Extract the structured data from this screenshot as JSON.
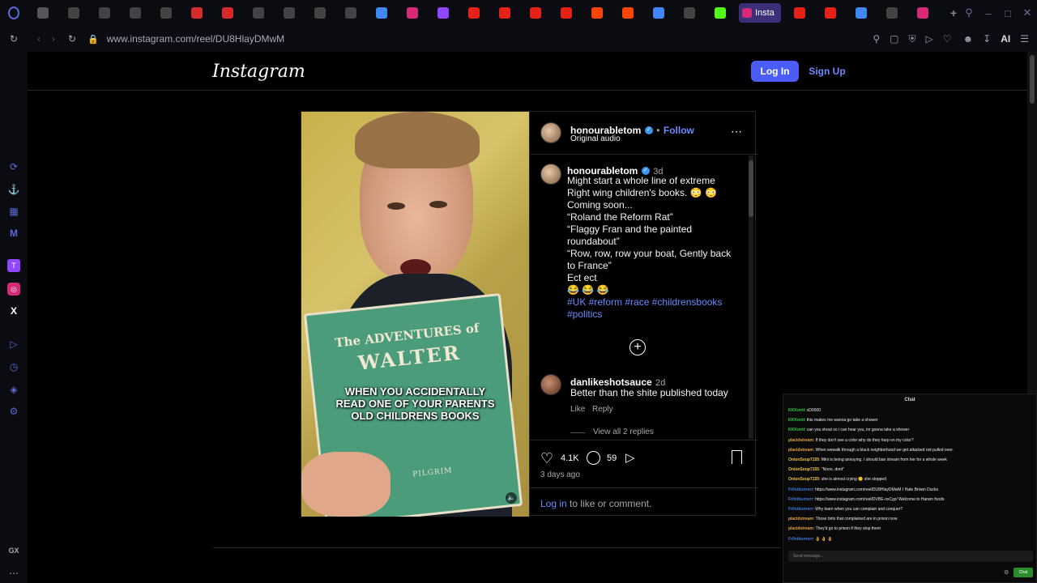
{
  "browser": {
    "url": "www.instagram.com/reel/DU8HlayDMwM",
    "active_tab_label": "Insta",
    "ai_label": "AI",
    "tabs": [
      {
        "icon": "mail-icon",
        "color": "#555"
      },
      {
        "icon": "x-icon",
        "color": "#444"
      },
      {
        "icon": "x-icon",
        "color": "#444"
      },
      {
        "icon": "x-icon",
        "color": "#444"
      },
      {
        "icon": "x-icon",
        "color": "#444"
      },
      {
        "icon": "red-play-icon",
        "color": "#d62b2b"
      },
      {
        "icon": "red-play-icon",
        "color": "#d62b2b"
      },
      {
        "icon": "x-icon",
        "color": "#444"
      },
      {
        "icon": "x-icon",
        "color": "#444"
      },
      {
        "icon": "x-icon",
        "color": "#444"
      },
      {
        "icon": "x-icon",
        "color": "#444"
      },
      {
        "icon": "google-icon",
        "color": "#4285f4"
      },
      {
        "icon": "instagram-icon",
        "color": "#d62976"
      },
      {
        "icon": "twitch-icon",
        "color": "#9146ff"
      },
      {
        "icon": "youtube-icon",
        "color": "#e62117"
      },
      {
        "icon": "youtube-icon",
        "color": "#e62117"
      },
      {
        "icon": "alert-icon",
        "color": "#e62117"
      },
      {
        "icon": "youtube-icon",
        "color": "#e62117"
      },
      {
        "icon": "reddit-icon",
        "color": "#ff4500"
      },
      {
        "icon": "reddit-icon",
        "color": "#ff4500"
      },
      {
        "icon": "google-icon",
        "color": "#4285f4"
      },
      {
        "icon": "x-icon",
        "color": "#444"
      },
      {
        "icon": "kick-icon",
        "color": "#53fc18"
      }
    ],
    "tabs_after": [
      {
        "icon": "youtube-icon",
        "color": "#e62117"
      },
      {
        "icon": "youtube-icon",
        "color": "#e62117"
      },
      {
        "icon": "google-icon",
        "color": "#4285f4"
      },
      {
        "icon": "x-icon",
        "color": "#444"
      },
      {
        "icon": "instagram-icon",
        "color": "#d62976"
      }
    ]
  },
  "instagram": {
    "logo": "Instagram",
    "login_label": "Log In",
    "signup_label": "Sign Up",
    "username": "honourabletom",
    "follow_label": "Follow",
    "audio_label": "Original audio",
    "caption_time": "3d",
    "caption_lines": [
      "Might start a whole line of extreme",
      "Right wing children's books. 😳 😳",
      "Coming soon...",
      "“Roland the Reform Rat”",
      "“Flaggy Fran and the painted",
      "roundabout”",
      "“Row, row, row your boat, Gently back",
      "to France”",
      "Ect ect",
      "😂 😂 😂"
    ],
    "hashtags_line1": "#UK #reform #race #childrensbooks",
    "hashtags_line2": "#politics",
    "comment": {
      "username": "danlikeshotsauce",
      "time": "2d",
      "text": "Better than the shite published today",
      "like_label": "Like",
      "reply_label": "Reply",
      "view_replies": "View all 2 replies"
    },
    "likes": "4.1K",
    "comments_count": "59",
    "posted": "3 days ago",
    "login_prompt_link": "Log in",
    "login_prompt_rest": " to like or comment.",
    "video_caption": [
      "WHEN YOU ACCIDENTALLY",
      "READ ONE OF YOUR PARENTS",
      "OLD CHILDRENS BOOKS"
    ],
    "book_title_1": "The ADVENTURES of",
    "book_title_2": "WALTER",
    "book_bottom": "PILGRIM"
  },
  "chat": {
    "title": "Chat",
    "placeholder": "Send message...",
    "send_label": "Chat",
    "messages": [
      {
        "user": "KKKonti",
        "text": "xD0000",
        "color": "#27c93f"
      },
      {
        "user": "KKKonti",
        "text": "this makes me wanna go take a shower",
        "color": "#27c93f"
      },
      {
        "user": "KKKonti",
        "text": "can you shout so i can hear you, im gonna take a shower",
        "color": "#27c93f"
      },
      {
        "user": "placidstream",
        "text": "If they don't see a color why do they harp on my color?",
        "color": "#e8a23a"
      },
      {
        "user": "placidstream",
        "text": "When wewalk through a black neighborhood we get attacked not pulled over.",
        "color": "#e8a23a"
      },
      {
        "user": "OnionSoup7155",
        "text": "Mini is being annoying. I should ban stream from her for a whole week",
        "color": "#f0c040"
      },
      {
        "user": "OnionSoup7155",
        "text": "\"Nooo, dont\"",
        "color": "#f0c040"
      },
      {
        "user": "OnionSoup7155",
        "text": "she is almost crying 🙂 she stopped",
        "color": "#f0c040"
      },
      {
        "user": "Fr0ntburnerr",
        "text": "https://www.instagram.com/reel/DU8HlayDMwM I Hate Brown Ducks",
        "color": "#3d7bd9"
      },
      {
        "user": "Fr0ntburnerr",
        "text": "https://www.instagram.com/reel/DVBE-oxCgz/ Welcome to Haram foods",
        "color": "#3d7bd9"
      },
      {
        "user": "Fr0ntburnerr",
        "text": "Why learn when you can complain and conquer?",
        "color": "#3d7bd9"
      },
      {
        "user": "placidstream",
        "text": "Those brits that complained are in prison now",
        "color": "#e8a23a"
      },
      {
        "user": "placidstream",
        "text": "They'd go to prison if they stop them",
        "color": "#e8a23a"
      },
      {
        "user": "Fr0ntburnerr",
        "text": "👌 👌 👌",
        "color": "#3d7bd9"
      }
    ]
  }
}
